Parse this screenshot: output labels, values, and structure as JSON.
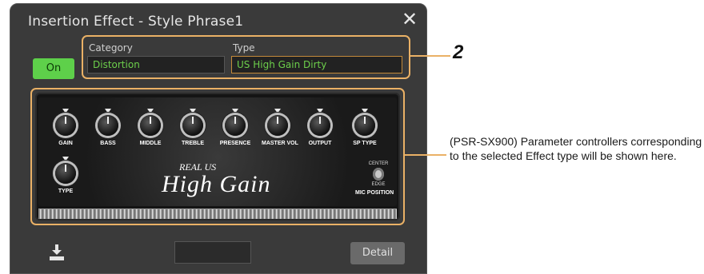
{
  "dialog": {
    "title": "Insertion Effect - Style Phrase1",
    "close_glyph": "✕",
    "on_label": "On",
    "category": {
      "label": "Category",
      "value": "Distortion"
    },
    "type": {
      "label": "Type",
      "value": "US High Gain Dirty"
    },
    "detail_label": "Detail"
  },
  "amp": {
    "knobs_row1": [
      "GAIN",
      "BASS",
      "MIDDLE",
      "TREBLE",
      "PRESENCE",
      "MASTER VOL",
      "OUTPUT",
      "SP TYPE"
    ],
    "knob_row2": "TYPE",
    "brand_small": "REAL US",
    "brand_big": "High Gain",
    "toggle_top": "CENTER",
    "toggle_bottom": "EDGE",
    "mic_position": "MIC POSITION"
  },
  "annotations": {
    "step_number": "2",
    "note": "(PSR-SX900) Parameter controllers corresponding to the selected Effect type will be shown here."
  },
  "colors": {
    "accent": "#eab166",
    "on_green": "#5ed04a",
    "field_text_green": "#6ccf4b",
    "dialog_bg": "#3a3a3a"
  }
}
